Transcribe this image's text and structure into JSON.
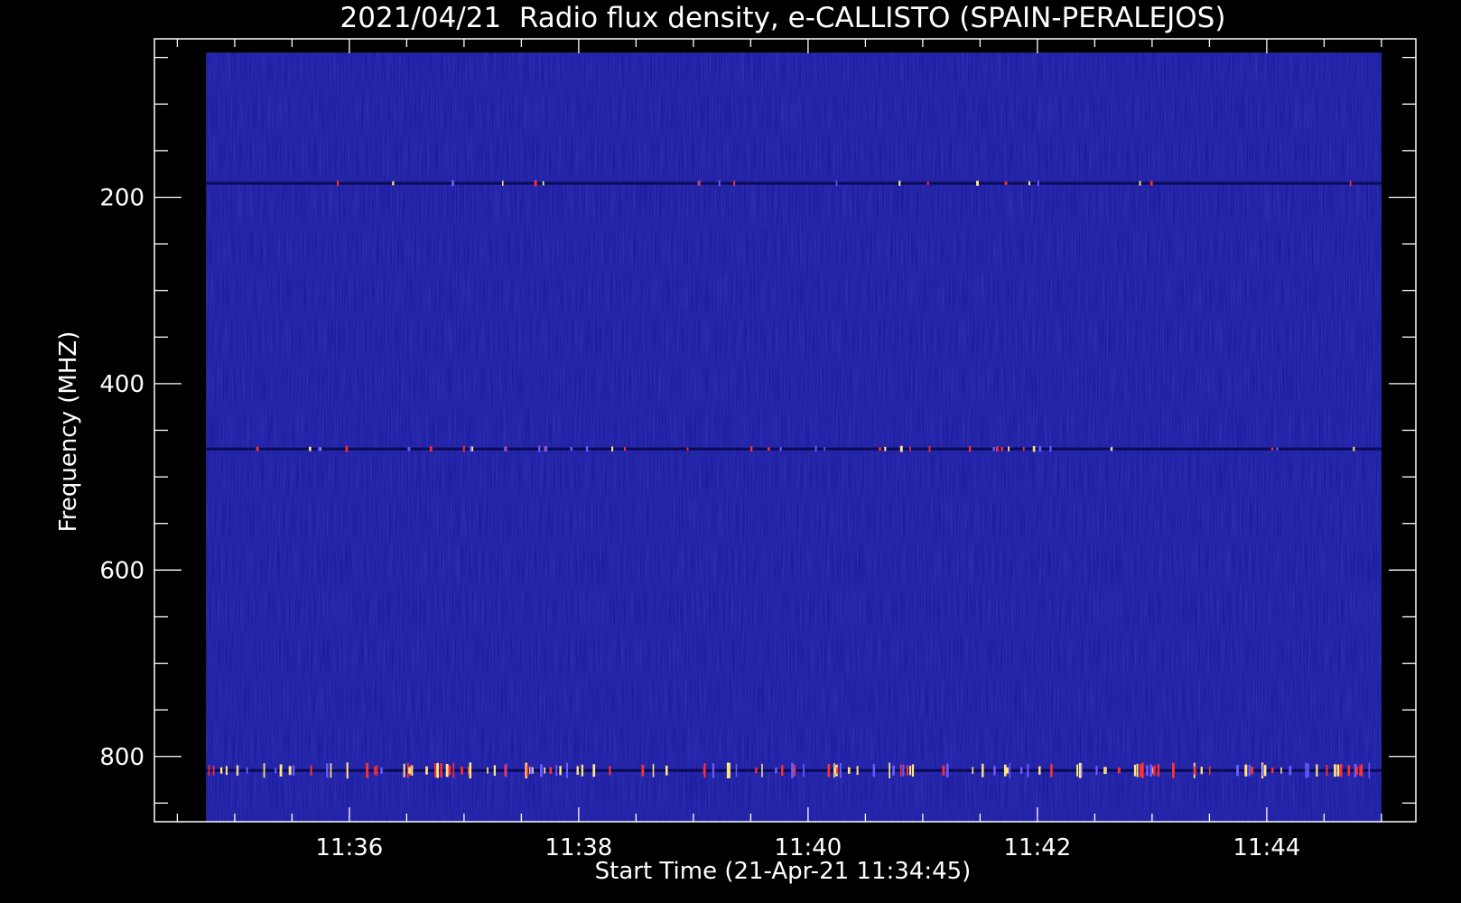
{
  "chart_data": {
    "type": "heatmap",
    "title": "2021/04/21  Radio flux density, e-CALLISTO (SPAIN-PERALEJOS)",
    "xlabel": "Start Time (21-Apr-21 11:34:45)",
    "ylabel": "Frequency (MHZ)",
    "x_tick_labels": [
      "11:36",
      "11:38",
      "11:40",
      "11:42",
      "11:44"
    ],
    "x_tick_minutes": [
      36,
      38,
      40,
      42,
      44
    ],
    "xlim_minutes": [
      34.3,
      45.3
    ],
    "data_x_range_minutes": [
      34.75,
      45.0
    ],
    "y_tick_labels": [
      "200",
      "400",
      "600",
      "800"
    ],
    "y_tick_values": [
      200,
      400,
      600,
      800
    ],
    "ylim": [
      870,
      30
    ],
    "data_y_range": [
      45,
      870
    ],
    "y_inverted": true,
    "grid": false,
    "background_color": "#14149a",
    "interference_bands_mhz": [
      185,
      470,
      815
    ],
    "colors": {
      "page": "#000000",
      "axis": "#ffffff",
      "burst_hot": "#ffe680",
      "burst_red": "#ff3030"
    }
  }
}
